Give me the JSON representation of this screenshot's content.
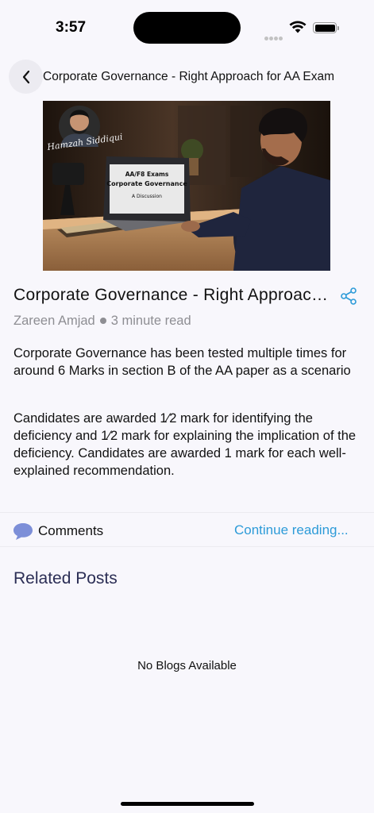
{
  "status_bar": {
    "time": "3:57"
  },
  "nav": {
    "title": "Corporate Governance - Right Approach for AA Exam"
  },
  "hero": {
    "signature": "Hamzah Siddiqui",
    "screen_line1": "AA/F8 Exams",
    "screen_line2": "Corporate Governance",
    "screen_line3": "A Discussion"
  },
  "post": {
    "title": "Corporate Governance - Right Approach for AA Exam",
    "author": "Zareen Amjad",
    "read_time": "3 minute read",
    "paragraphs": [
      "Corporate Governance has been tested multiple times for around 6 Marks in section B of the AA paper as a scenario",
      "Candidates are awarded 1⁄2 mark for identifying the deficiency and 1⁄2 mark for explaining the implication of the deficiency. Candidates are awarded 1 mark for each well-explained recommendation."
    ]
  },
  "actions": {
    "comments_label": "Comments",
    "continue_label": "Continue reading..."
  },
  "related": {
    "title": "Related Posts",
    "empty_message": "No Blogs Available"
  },
  "colors": {
    "accent": "#2d9bd8",
    "related_title": "#2b2e55",
    "comment_icon": "#7d8fd8",
    "background": "#f8f7fc"
  },
  "icons": {
    "back": "chevron-left-icon",
    "share": "share-icon",
    "comment": "comment-bubble-icon",
    "wifi": "wifi-icon",
    "battery": "battery-icon",
    "signal": "signal-icon"
  }
}
